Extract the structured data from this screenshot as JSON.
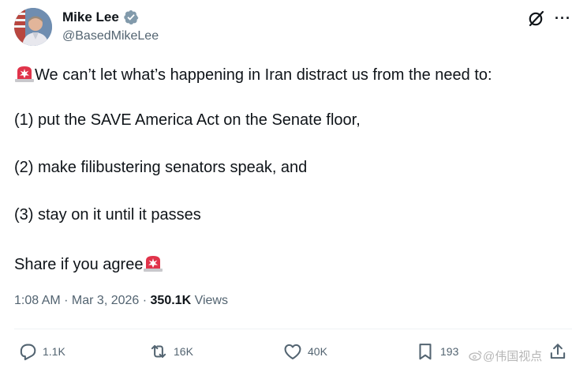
{
  "author": {
    "name": "Mike Lee",
    "handle": "@BasedMikeLee",
    "verified": true
  },
  "tweet": {
    "line1": "We can’t let what’s happening in Iran distract us from the need to:",
    "line2": "(1) put the SAVE America Act on the Senate floor,",
    "line3": "(2) make filibustering senators speak, and",
    "line4": "(3) stay on it until it passes",
    "line5": "Share if you agree",
    "emoji": "police-light-emoji"
  },
  "meta": {
    "time": "1:08 AM",
    "separator": " · ",
    "date": "Mar 3, 2026",
    "views_count": "350.1K",
    "views_label": " Views"
  },
  "actions": {
    "replies": "1.1K",
    "reposts": "16K",
    "likes": "40K",
    "bookmarks": "193"
  },
  "icons": {
    "reply": "reply-icon",
    "repost": "repost-icon",
    "like": "heart-icon",
    "bookmark": "bookmark-icon",
    "share": "share-icon",
    "grok": "grok-icon",
    "more": "more-icon",
    "verified": "verified-badge-icon"
  },
  "colors": {
    "text": "#0f1419",
    "muted": "#536471",
    "verified": "#829aab",
    "siren": "#e0334a"
  },
  "watermark": "@伟国视点"
}
